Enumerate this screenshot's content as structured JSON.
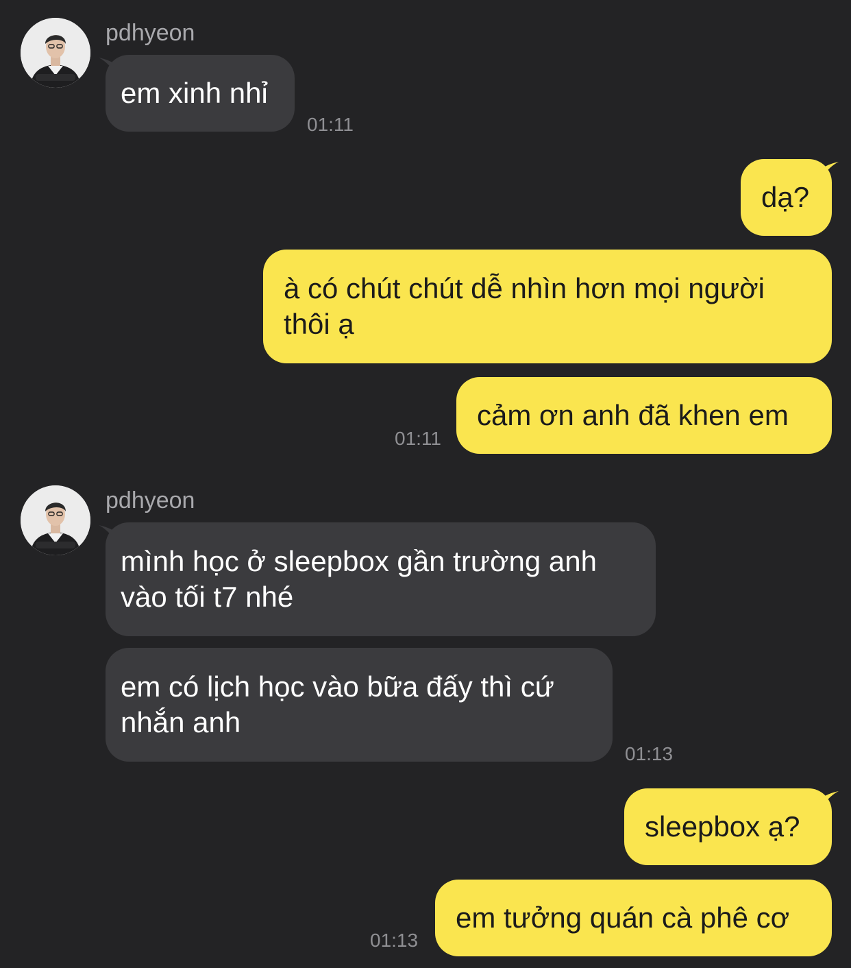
{
  "colors": {
    "background": "#232325",
    "incoming_bubble": "#3b3b3e",
    "outgoing_bubble": "#fae54f",
    "sender_name": "#a9a9ad",
    "timestamp": "#8f8f93"
  },
  "messages": {
    "group1": {
      "sender": "pdhyeon",
      "bubble1": "em xinh nhỉ",
      "time": "01:11"
    },
    "group2": {
      "bubble1": "dạ?",
      "bubble2_line1": "à có chút chút dễ nhìn hơn mọi người",
      "bubble2_line2": "thôi ạ",
      "bubble3": "cảm ơn anh đã khen em",
      "time": "01:11"
    },
    "group3": {
      "sender": "pdhyeon",
      "bubble1_line1": "mình học ở sleepbox gần trường anh",
      "bubble1_line2": "vào tối t7 nhé",
      "bubble2_line1": "em có lịch học vào bữa đấy thì cứ",
      "bubble2_line2": "nhắn anh",
      "time": "01:13"
    },
    "group4": {
      "bubble1": "sleepbox ạ?",
      "bubble2": "em tưởng quán cà phê cơ",
      "time": "01:13"
    }
  }
}
